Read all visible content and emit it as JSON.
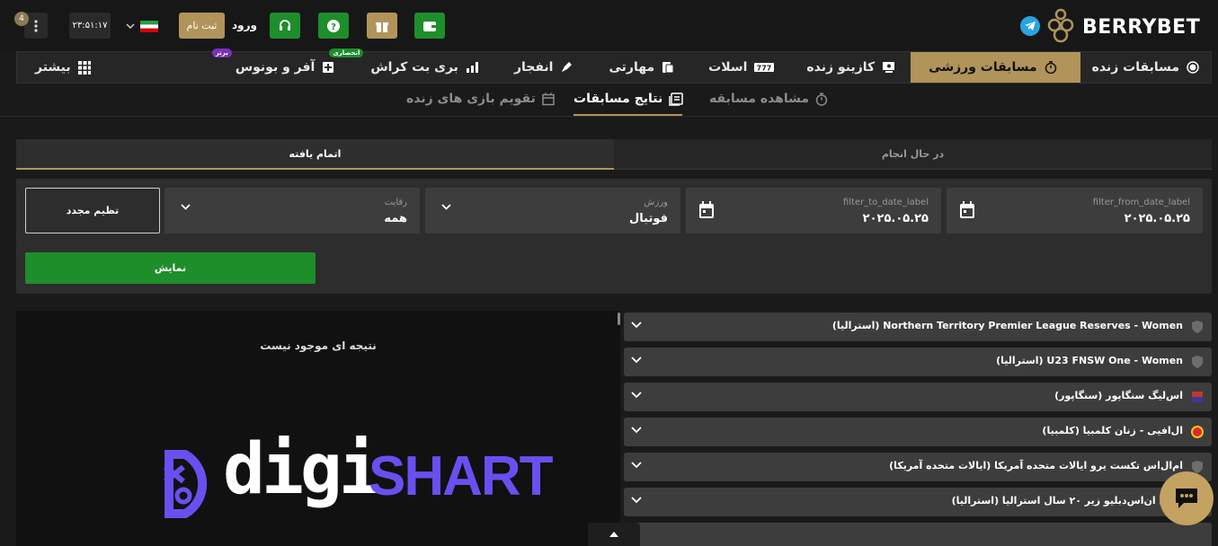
{
  "header": {
    "brand": "BERRYBET",
    "notif_count": "4",
    "clock": "۲۳:۵۱:۱۷",
    "register_label": "ثبت نام",
    "login_label": "ورود",
    "colors": {
      "gold": "#b0945a",
      "green": "#1e8e2b"
    }
  },
  "nav": {
    "items": [
      {
        "label": "مسابقات زنده",
        "icon": "live-circle-icon"
      },
      {
        "label": "مسابقات ورزشی",
        "icon": "stopwatch-icon",
        "active": true
      },
      {
        "label": "کازینو زنده",
        "icon": "casino-icon"
      },
      {
        "label": "اسلات",
        "icon": "slot-icon"
      },
      {
        "label": "مهارتی",
        "icon": "cards-icon"
      },
      {
        "label": "انفجار",
        "icon": "rocket-icon"
      },
      {
        "label": "بری بت کراش",
        "icon": "crash-chart-icon",
        "badge": "انحصاری"
      },
      {
        "label": "آفر و بونوس",
        "icon": "bonus-icon",
        "badge": "برتر"
      },
      {
        "label": "بیشتر",
        "icon": "grid-icon"
      }
    ]
  },
  "subnav": {
    "watch": "مشاهده مسابقه",
    "results": "نتایج مسابقات",
    "calendar": "تقویم بازی های زنده"
  },
  "tabs": {
    "in_progress": "در حال انجام",
    "finished": "اتمام یافته"
  },
  "filters": {
    "from_label": "filter_from_date_label",
    "from_value": "۲۰۲۵.۰۵.۲۵",
    "to_label": "filter_to_date_label",
    "to_value": "۲۰۲۵.۰۵.۲۵",
    "sport_label": "ورزش",
    "sport_value": "فوتبال",
    "competition_label": "رقابت",
    "competition_value": "همه",
    "reset_label": "تظیم مجدد",
    "show_label": "نمایش"
  },
  "results": {
    "empty_text": "نتیجه ای موجود نیست"
  },
  "leagues": [
    {
      "name": "Northern Territory Premier League Reserves - Women (استرالیا)",
      "icon": "shield-icon"
    },
    {
      "name": "U23 FNSW One - Women (استرالیا)",
      "icon": "shield-icon"
    },
    {
      "name": "اس‌لیگ سنگاپور (سنگاپور)",
      "icon": "league-logo-icon"
    },
    {
      "name": "ال‌افیی - زنان کلمبیا (کلمبیا)",
      "icon": "league-logo-icon"
    },
    {
      "name": "ام‌ال‌اس تکست یرو ایالات متحده آمریکا (ایالات متحده آمریکا)",
      "icon": "shield-icon"
    },
    {
      "name": "ان‌ال ان‌اس‌دبلیو زیر ۲۰ سال استرالیا (استرالیا)",
      "icon": "shield-icon"
    }
  ],
  "watermark": {
    "left": "digi",
    "right": "SHART"
  }
}
